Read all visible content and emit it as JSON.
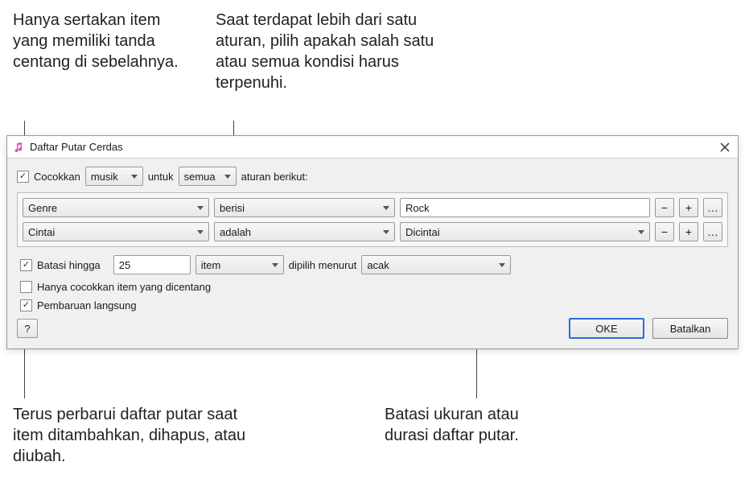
{
  "callouts": {
    "top_left": "Hanya sertakan item yang memiliki tanda centang di sebelahnya.",
    "top_right": "Saat terdapat lebih dari satu aturan, pilih apakah salah satu atau semua kondisi harus terpenuhi.",
    "bottom_left": "Terus perbarui daftar putar saat item ditambahkan, dihapus, atau diubah.",
    "bottom_right": "Batasi ukuran atau durasi daftar putar."
  },
  "dialog": {
    "title": "Daftar Putar Cerdas",
    "match": {
      "checkbox_label": "Cocokkan",
      "media_type": "musik",
      "for_text": "untuk",
      "match_mode": "semua",
      "suffix": "aturan berikut:"
    },
    "rules": [
      {
        "field": "Genre",
        "op": "berisi",
        "value": "Rock",
        "value_kind": "text"
      },
      {
        "field": "Cintai",
        "op": "adalah",
        "value": "Dicintai",
        "value_kind": "select"
      }
    ],
    "limit": {
      "checkbox_label": "Batasi hingga",
      "amount": "25",
      "unit": "item",
      "selected_by_text": "dipilih menurut",
      "selected_by": "acak"
    },
    "only_checked_label": "Hanya cocokkan item yang dicentang",
    "live_update_label": "Pembaruan langsung",
    "buttons": {
      "help": "?",
      "ok": "OKE",
      "cancel": "Batalkan"
    },
    "rule_buttons": {
      "minus": "−",
      "plus": "+",
      "more": "…"
    }
  }
}
